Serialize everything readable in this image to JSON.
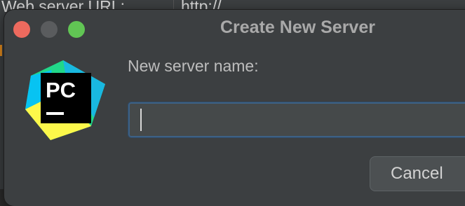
{
  "background": {
    "label": "Web server URL:",
    "value": "http://"
  },
  "dialog": {
    "title": "Create New Server",
    "logo_text": "PC",
    "field_label": "New server name:",
    "name_value": "",
    "cancel_label": "Cancel"
  },
  "colors": {
    "close": "#ed6a5e",
    "minimize": "#5a5c5e",
    "zoom": "#61c554",
    "focus_border": "#3d6185"
  },
  "icons": {
    "app_logo": "pycharm-logo-icon"
  }
}
